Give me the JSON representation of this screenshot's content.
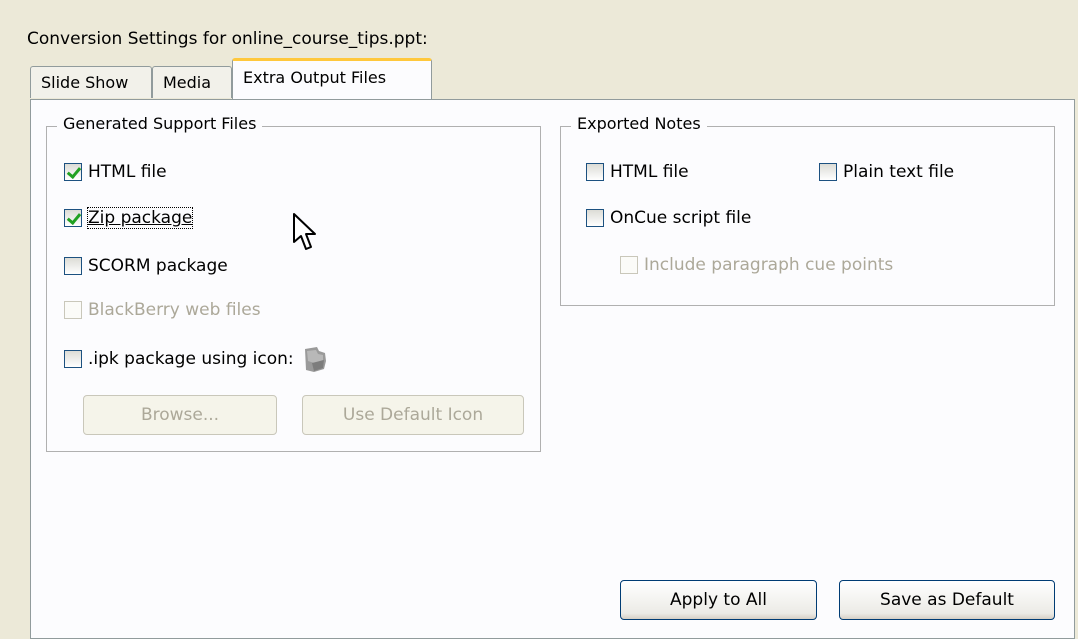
{
  "title": "Conversion Settings for online_course_tips.ppt:",
  "tabs": [
    "Slide Show",
    "Media",
    "Extra Output Files"
  ],
  "support": {
    "legend": "Generated Support Files",
    "html": "HTML file",
    "zip": "Zip package",
    "scorm": "SCORM package",
    "blackberry": "BlackBerry web files",
    "ipk": ".ipk package using icon:",
    "browse": "Browse...",
    "default_icon": "Use Default Icon"
  },
  "notes": {
    "legend": "Exported Notes",
    "html": "HTML file",
    "plain": "Plain text file",
    "oncue": "OnCue script file",
    "paragraph": "Include paragraph cue points"
  },
  "buttons": {
    "apply_all": "Apply to All",
    "save_default": "Save as Default"
  },
  "icons": {
    "ipk_icon": "ipk-package-icon",
    "cursor": "mouse-pointer-icon"
  }
}
